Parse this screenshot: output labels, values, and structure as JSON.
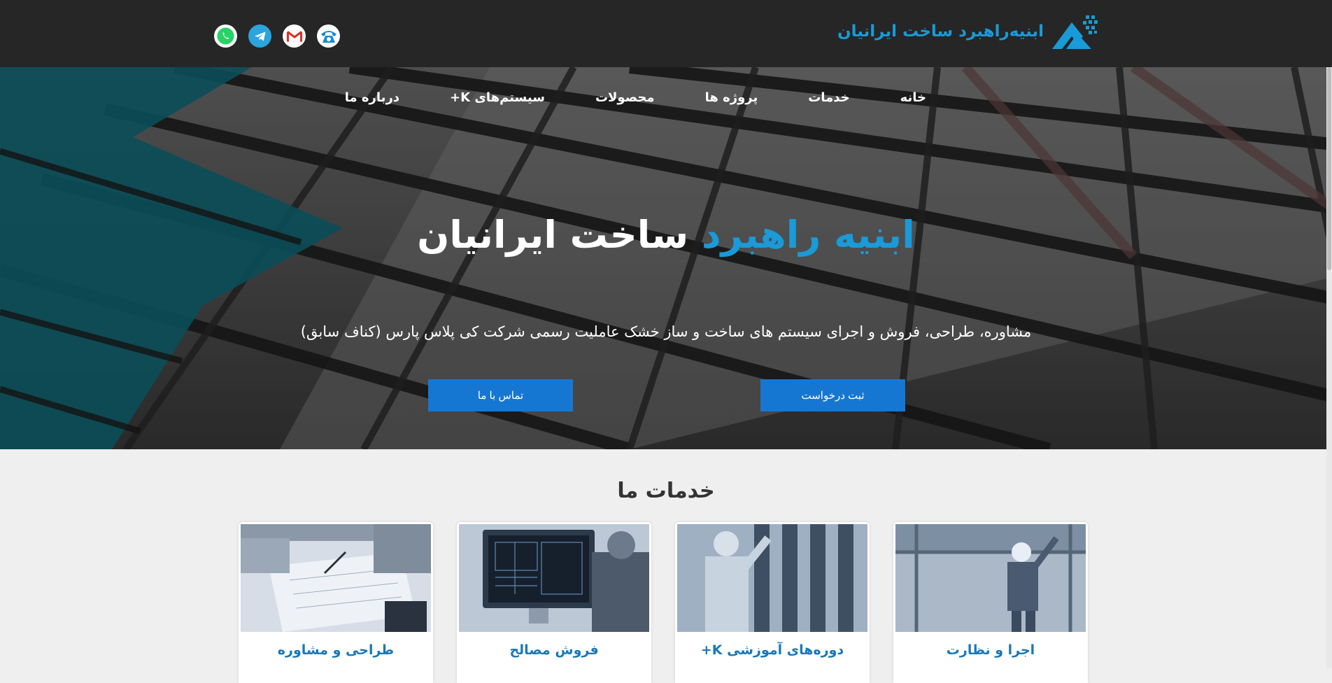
{
  "header": {
    "brand_name": "ابنیه‌راهبرد ساخت ایرانیان",
    "social": [
      {
        "icon": "phone-icon",
        "label": "phone"
      },
      {
        "icon": "gmail-icon",
        "label": "gmail"
      },
      {
        "icon": "telegram-icon",
        "label": "telegram"
      },
      {
        "icon": "whatsapp-icon",
        "label": "whatsapp"
      }
    ]
  },
  "nav": {
    "items": [
      {
        "label": "خانه"
      },
      {
        "label": "خدمات"
      },
      {
        "label": "پروژه ها"
      },
      {
        "label": "محصولات"
      },
      {
        "label": "سیستم‌های K+"
      },
      {
        "label": "درباره ما"
      }
    ]
  },
  "hero": {
    "title_accent": "ابنیه راهبرد",
    "title_rest": "ساخت ایرانیان",
    "subtitle": "مشاوره، طراحی، فروش و اجرای سیستم های ساخت و ساز خشک عاملیت رسمی شرکت کی پلاس پارس (کناف سابق)",
    "request_button": "ثبت درخواست",
    "contact_button": "تماس با ما"
  },
  "services": {
    "title": "خدمات ما",
    "cards": [
      {
        "title": "اجرا و نظارت"
      },
      {
        "title": "دوره‌های آموزشی K+"
      },
      {
        "title": "فروش مصالح"
      },
      {
        "title": "طراحی و مشاوره"
      }
    ]
  },
  "colors": {
    "accent": "#1a9ad8",
    "header_bg": "#262626",
    "button": "#1677d2",
    "card_title": "#1a78b8"
  }
}
